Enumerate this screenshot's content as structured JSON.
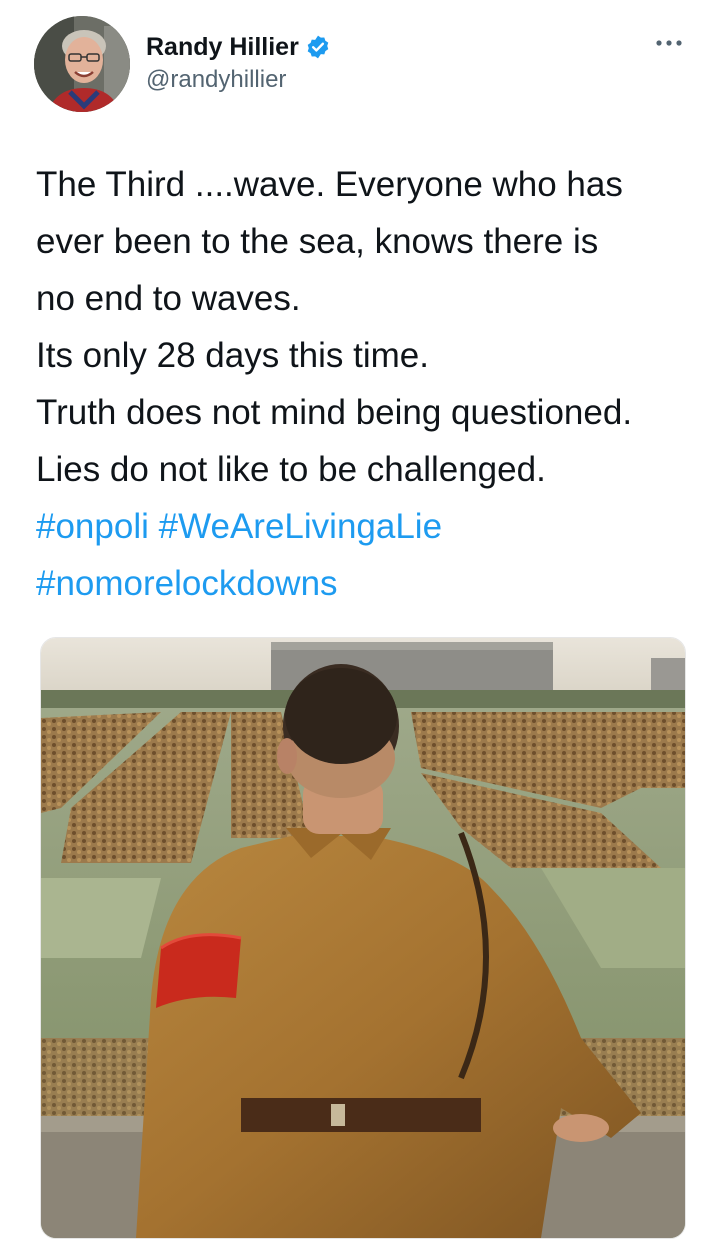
{
  "author": {
    "display_name": "Randy Hillier",
    "handle": "@randyhillier",
    "verified": true,
    "verified_color": "#1d9bf0"
  },
  "tweet": {
    "lines": [
      "The Third ....wave. Everyone who has",
      "ever been to the sea, knows there is",
      "no end to waves.",
      "Its only 28 days this time.",
      "Truth does not mind being questioned.",
      "Lies do not like to be challenged."
    ],
    "hashtags": [
      "#onpoli",
      "#WeAreLivingaLie",
      "#nomorelockdowns"
    ],
    "hashtag_color": "#1d9bf0"
  },
  "icons": {
    "more": "more-options-icon",
    "verified": "verified-badge-icon"
  }
}
